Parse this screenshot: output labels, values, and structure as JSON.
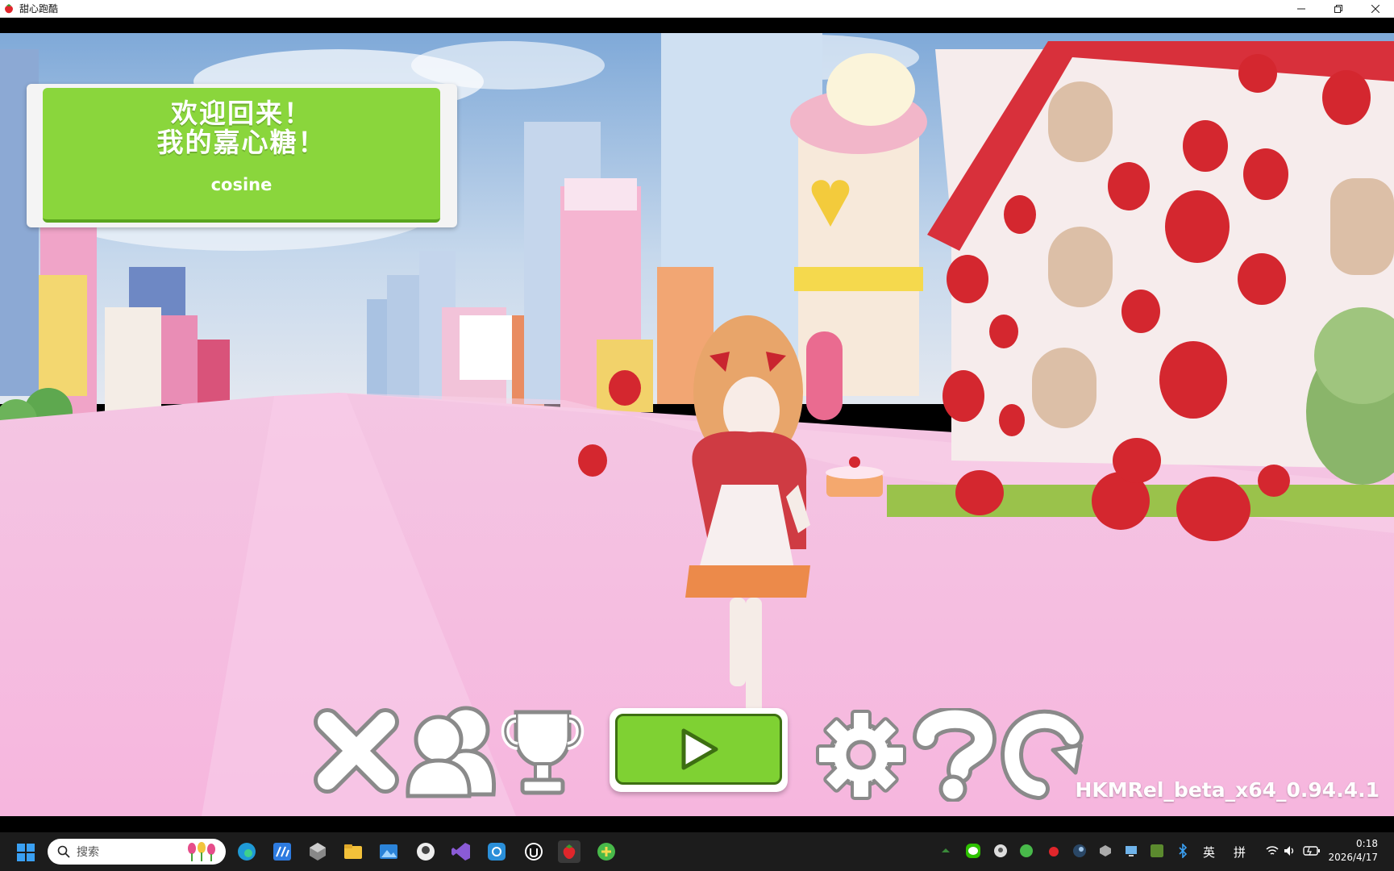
{
  "window": {
    "title": "甜心跑酷",
    "controls": [
      "minimize-icon",
      "restore-icon",
      "close-icon"
    ]
  },
  "welcome_panel": {
    "line1": "欢迎回来！",
    "line2": "我的嘉心糖！",
    "username": "cosine"
  },
  "main_menu": {
    "buttons": [
      {
        "name": "exit",
        "icon": "close-x-icon"
      },
      {
        "name": "friends",
        "icon": "users-icon"
      },
      {
        "name": "achievements",
        "icon": "trophy-icon"
      },
      {
        "name": "play",
        "icon": "play-icon"
      },
      {
        "name": "settings",
        "icon": "gear-icon"
      },
      {
        "name": "help",
        "icon": "question-icon"
      },
      {
        "name": "refresh",
        "icon": "refresh-icon"
      }
    ],
    "version": "HKMRel_beta_x64_0.94.4.1"
  },
  "taskbar": {
    "search_placeholder": "搜索",
    "tray_lang": "英",
    "tray_ime": "拼",
    "time": "0:18",
    "date": "2026/4/17"
  },
  "colors": {
    "accent_green": "#8ad63c",
    "road_pink": "#f6bfe0",
    "sky": "#a9c7e6"
  }
}
